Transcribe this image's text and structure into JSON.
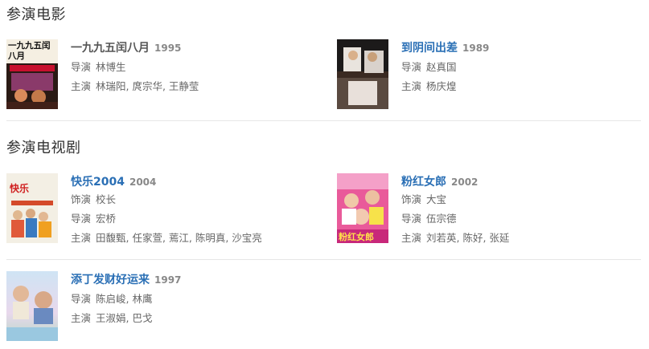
{
  "sections": [
    {
      "title": "参演电影",
      "items": [
        {
          "title": "一九九五闰八月",
          "year": "1995",
          "rows": [
            {
              "label": "导演",
              "value": "林博生"
            },
            {
              "label": "主演",
              "value": "林瑞阳, 庹宗华, 王静莹"
            }
          ],
          "poster_text": "一九九五闰八月"
        },
        {
          "title": "到阴间出差",
          "year": "1989",
          "rows": [
            {
              "label": "导演",
              "value": "赵真国"
            },
            {
              "label": "主演",
              "value": "杨庆煌"
            }
          ]
        }
      ]
    },
    {
      "title": "参演电视剧",
      "items": [
        {
          "title": "快乐2004",
          "year": "2004",
          "rows": [
            {
              "label": "饰演",
              "value": "校长"
            },
            {
              "label": "导演",
              "value": "宏桥"
            },
            {
              "label": "主演",
              "value": "田馥甄, 任家萱, 蔫江, 陈明真, 沙宝亮"
            }
          ],
          "poster_text": "快乐"
        },
        {
          "title": "粉红女郎",
          "year": "2002",
          "rows": [
            {
              "label": "饰演",
              "value": "大宝"
            },
            {
              "label": "导演",
              "value": "伍宗德"
            },
            {
              "label": "主演",
              "value": "刘若英, 陈好, 张延"
            }
          ],
          "poster_text": "粉红女郎"
        },
        {
          "title": "添丁发财好运来",
          "year": "1997",
          "rows": [
            {
              "label": "导演",
              "value": "陈启峻, 林鹰"
            },
            {
              "label": "主演",
              "value": "王淑娟, 巴戈"
            }
          ]
        }
      ]
    }
  ],
  "colors": {
    "link_blue": "#2a6fb5",
    "title_dark": "#555555",
    "divider": "#e6e6e6"
  }
}
